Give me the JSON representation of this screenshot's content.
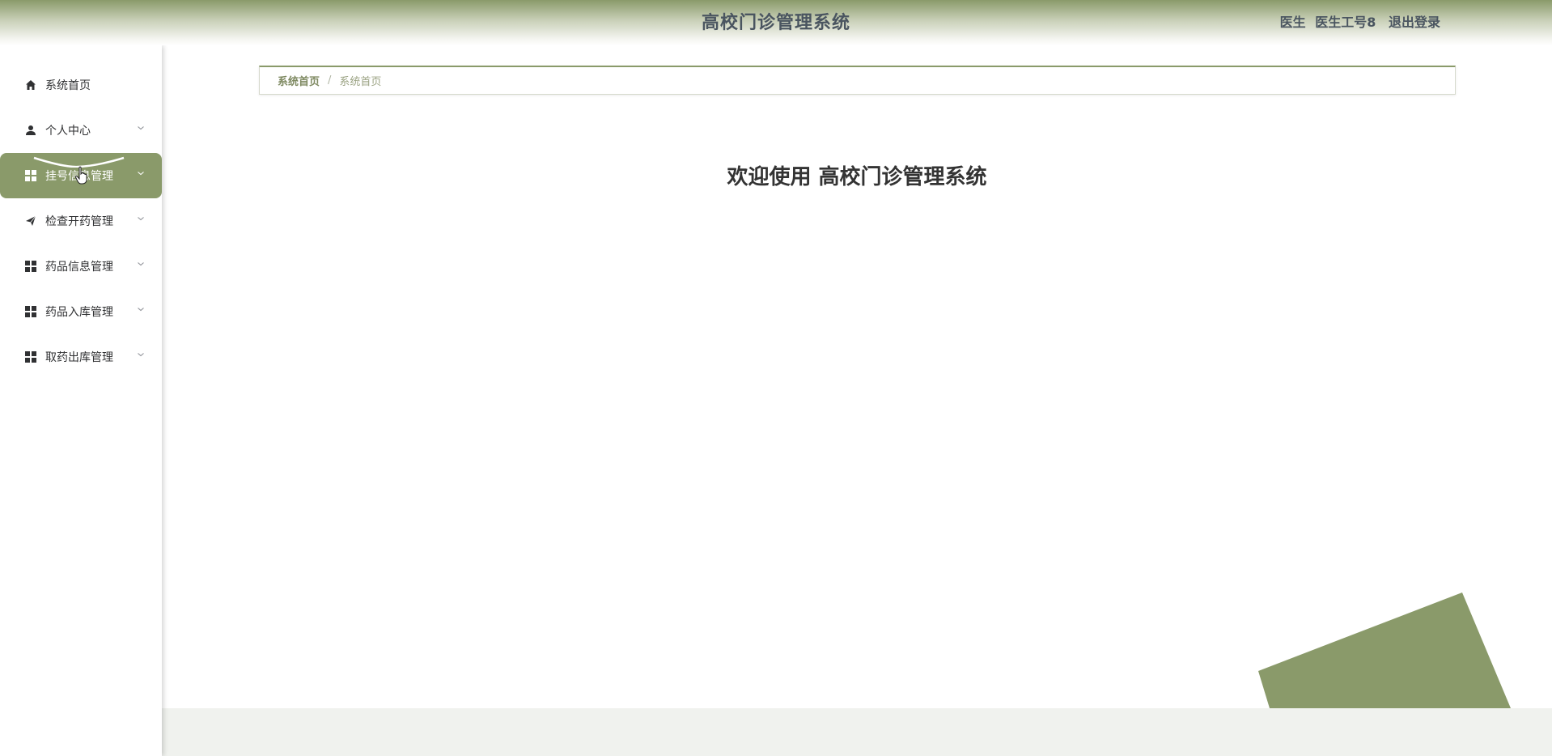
{
  "header": {
    "title": "高校门诊管理系统",
    "role": "医生",
    "username": "医生工号8",
    "logout_label": "退出登录"
  },
  "sidebar": {
    "items": [
      {
        "label": "系统首页",
        "icon": "home-icon"
      },
      {
        "label": "个人中心",
        "icon": "user-icon"
      },
      {
        "label": "挂号信息管理",
        "icon": "grid-icon",
        "active": true
      },
      {
        "label": "检查开药管理",
        "icon": "send-icon"
      },
      {
        "label": "药品信息管理",
        "icon": "grid-icon"
      },
      {
        "label": "药品入库管理",
        "icon": "grid-icon"
      },
      {
        "label": "取药出库管理",
        "icon": "grid-icon"
      }
    ]
  },
  "breadcrumb": {
    "first": "系统首页",
    "separator": "/",
    "current": "系统首页"
  },
  "main": {
    "welcome": "欢迎使用 高校门诊管理系统"
  },
  "colors": {
    "accent": "#8a9a6a",
    "footer_band": "#f0f2ee"
  }
}
